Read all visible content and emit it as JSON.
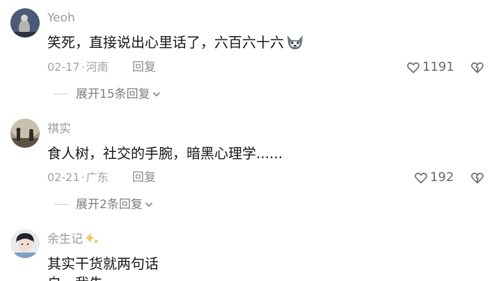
{
  "comments": [
    {
      "username": "Yeoh",
      "text": "笑死，直接说出心里话了，六百六十六",
      "date": "02-17",
      "location": "河南",
      "reply_label": "回复",
      "likes": "1191",
      "expand_label": "展开15条回复",
      "content_icon": "wolf-emoji-icon"
    },
    {
      "username": "祺实",
      "text": "食人树，社交的手腕，暗黑心理学......",
      "date": "02-21",
      "location": "广东",
      "reply_label": "回复",
      "likes": "192",
      "expand_label": "展开2条回复"
    },
    {
      "username": "余生记",
      "username_icon": "sparkle-badge-icon",
      "text": "其实干货就两句话",
      "partial_text": "自…我先"
    }
  ],
  "meta_separator": "·"
}
